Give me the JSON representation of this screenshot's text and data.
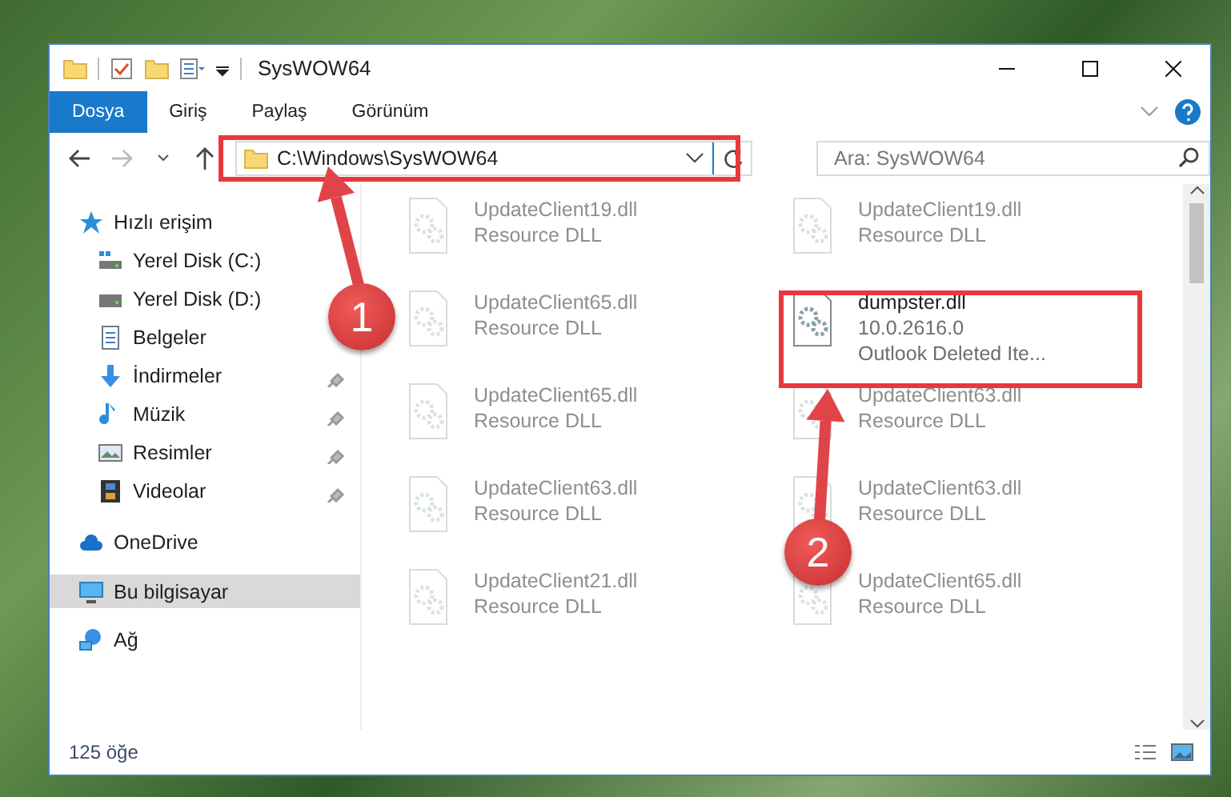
{
  "window": {
    "title": "SysWOW64"
  },
  "ribbon_tabs": [
    {
      "label": "Dosya",
      "selected": true
    },
    {
      "label": "Giriş",
      "selected": false
    },
    {
      "label": "Paylaş",
      "selected": false
    },
    {
      "label": "Görünüm",
      "selected": false
    }
  ],
  "address": {
    "path": "C:\\Windows\\SysWOW64"
  },
  "search": {
    "placeholder": "Ara: SysWOW64"
  },
  "sidebar": {
    "items": [
      {
        "label": "Hızlı erişim",
        "selected": false,
        "children": [
          {
            "label": "Yerel Disk (C:)",
            "pinned": false,
            "selected": false
          },
          {
            "label": "Yerel Disk (D:)",
            "pinned": false,
            "selected": false
          },
          {
            "label": "Belgeler",
            "pinned": false,
            "selected": false
          },
          {
            "label": "İndirmeler",
            "pinned": true,
            "selected": false
          },
          {
            "label": "Müzik",
            "pinned": true,
            "selected": false
          },
          {
            "label": "Resimler",
            "pinned": true,
            "selected": false
          },
          {
            "label": "Videolar",
            "pinned": true,
            "selected": false
          }
        ]
      },
      {
        "label": "OneDrive",
        "selected": false
      },
      {
        "label": "Bu bilgisayar",
        "selected": true
      },
      {
        "label": "Ağ",
        "selected": false
      }
    ]
  },
  "files": [
    {
      "name": "UpdateClient19.dll",
      "lines": [
        "Resource DLL"
      ],
      "blurred": true
    },
    {
      "name": "UpdateClient19.dll",
      "lines": [
        "Resource DLL"
      ],
      "blurred": true
    },
    {
      "name": "UpdateClient65.dll",
      "lines": [
        "Resource DLL"
      ],
      "blurred": true
    },
    {
      "name": "dumpster.dll",
      "lines": [
        "10.0.2616.0",
        "Outlook Deleted Ite..."
      ],
      "blurred": false
    },
    {
      "name": "UpdateClient65.dll",
      "lines": [
        "Resource DLL"
      ],
      "blurred": true
    },
    {
      "name": "UpdateClient63.dll",
      "lines": [
        "Resource DLL"
      ],
      "blurred": true
    },
    {
      "name": "UpdateClient63.dll",
      "lines": [
        "Resource DLL"
      ],
      "blurred": true
    },
    {
      "name": "UpdateClient63.dll",
      "lines": [
        "Resource DLL"
      ],
      "blurred": true
    },
    {
      "name": "UpdateClient21.dll",
      "lines": [
        "Resource DLL"
      ],
      "blurred": true
    },
    {
      "name": "UpdateClient65.dll",
      "lines": [
        "Resource DLL"
      ],
      "blurred": true
    }
  ],
  "status_bar": {
    "item_count": "125 öğe"
  },
  "annotations": [
    {
      "number": "1"
    },
    {
      "number": "2"
    }
  ]
}
